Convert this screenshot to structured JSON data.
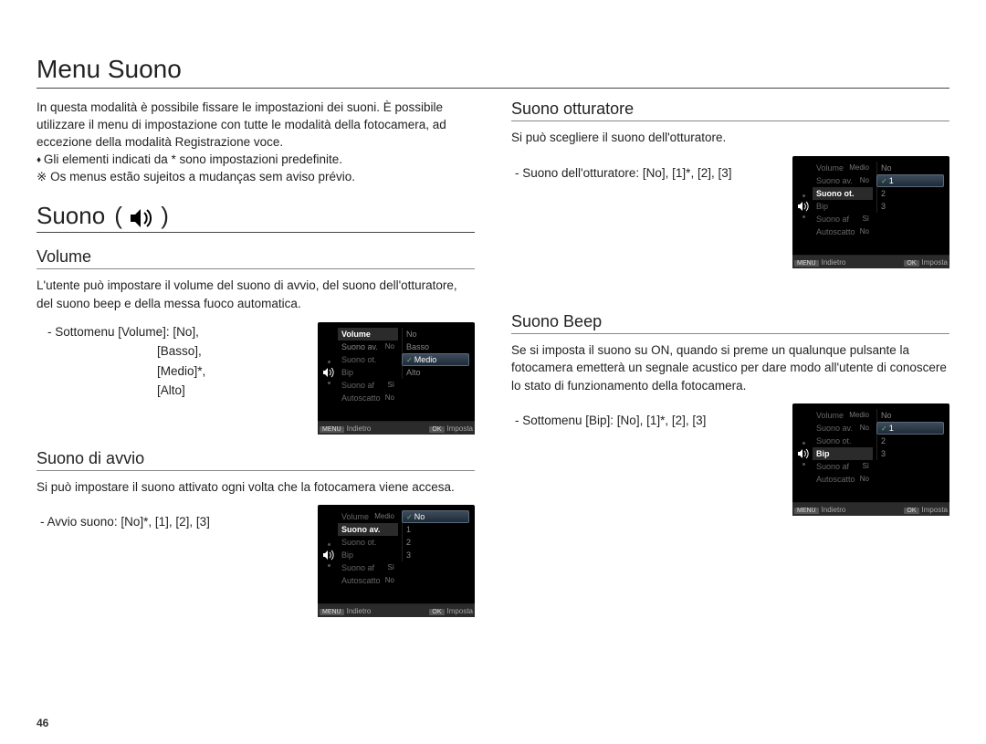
{
  "page_number": "46",
  "page_title": "Menu Suono",
  "intro": {
    "p1": "In questa modalità è possibile fissare le impostazioni dei suoni. È possibile utilizzare il menu di impostazione con tutte le modalità della fotocamera, ad eccezione della modalità Registrazione voce.",
    "bullet": "Gli elementi indicati da * sono impostazioni predefinite.",
    "note": "Os menus estão sujeitos a mudanças sem aviso prévio."
  },
  "section_title": "Suono",
  "section_icon_name": "sound-icon",
  "volume": {
    "title": "Volume",
    "desc": "L'utente può impostare il volume del suono di avvio, del suono dell'otturatore, del suono beep e della messa fuoco automatica.",
    "submenu_label": "Sottomenu [Volume]:",
    "submenu_options": [
      "[No]",
      "[Basso]",
      "[Medio]*",
      "[Alto]"
    ]
  },
  "avvio": {
    "title": "Suono di avvio",
    "desc": "Si può impostare il suono attivato ogni volta che la fotocamera viene accesa.",
    "submenu": "Avvio suono: [No]*, [1], [2], [3]"
  },
  "otturatore": {
    "title": "Suono otturatore",
    "desc": "Si può scegliere il suono dell'otturatore.",
    "submenu": "Suono dell'otturatore: [No], [1]*, [2], [3]"
  },
  "beep": {
    "title": "Suono Beep",
    "desc": "Se si imposta il suono su ON, quando si preme un qualunque pulsante la fotocamera emetterà un segnale acustico per dare modo all'utente di conoscere lo stato di funzionamento della fotocamera.",
    "submenu": "Sottomenu [Bip]: [No], [1]*, [2], [3]"
  },
  "lcd_common": {
    "menu_items": [
      "Volume",
      "Suono av.",
      "Suono ot.",
      "Bip",
      "Suono af",
      "Autoscatto"
    ],
    "footer_back_tag": "MENU",
    "footer_back": "Indietro",
    "footer_ok_tag": "OK",
    "footer_ok": "Imposta",
    "right_val_medio": "Medio",
    "right_val_no": "No",
    "right_val_si": "Sì"
  },
  "lcd_volume": {
    "selected_menu_index": 0,
    "options": [
      "No",
      "Basso",
      "Medio",
      "Alto"
    ],
    "checked_index": 2,
    "selected_option_index": 2
  },
  "lcd_avvio": {
    "selected_menu_index": 1,
    "options": [
      "No",
      "1",
      "2",
      "3"
    ],
    "checked_index": 0,
    "selected_option_index": 0
  },
  "lcd_otturatore": {
    "selected_menu_index": 2,
    "options": [
      "No",
      "1",
      "2",
      "3"
    ],
    "checked_index": 1,
    "selected_option_index": 1
  },
  "lcd_beep": {
    "selected_menu_index": 3,
    "options": [
      "No",
      "1",
      "2",
      "3"
    ],
    "checked_index": 1,
    "selected_option_index": 1
  }
}
